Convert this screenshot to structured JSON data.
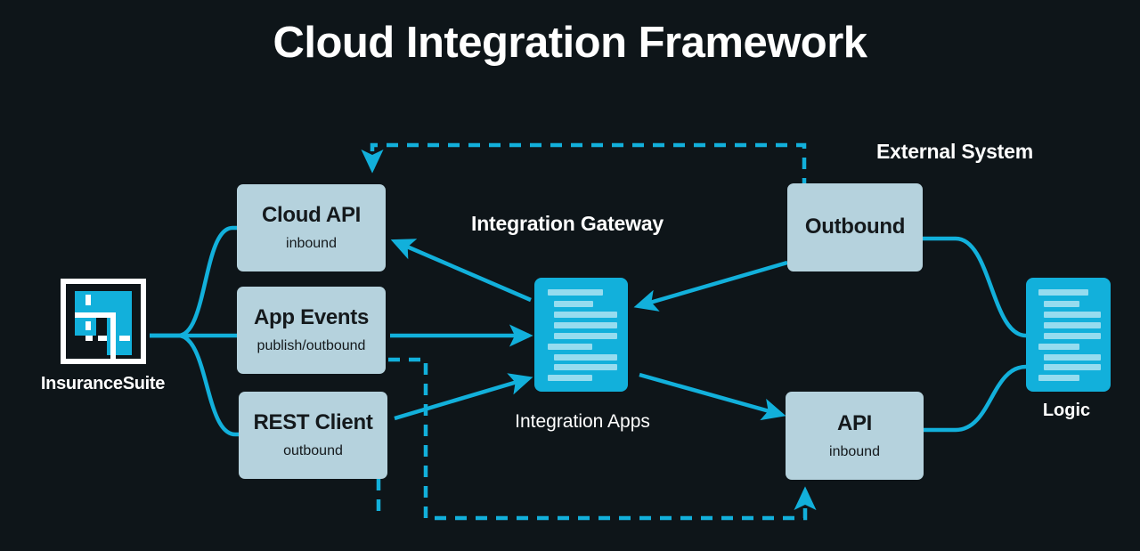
{
  "page": {
    "title": "Cloud Integration Framework",
    "background_color": "#0e1519"
  },
  "colors": {
    "background": "#0e1519",
    "accent_cyan": "#12b0db",
    "box_fill": "#b5d2dd",
    "box_text": "#14191c",
    "doc_line": "#96dcef",
    "text_white": "#ffffff"
  },
  "headings": {
    "integration_gateway": "Integration Gateway",
    "external_system": "External System"
  },
  "source_system": {
    "label": "InsuranceSuite",
    "icon": "insurancesuite-logo-icon"
  },
  "left_boxes": [
    {
      "title": "Cloud API",
      "subtitle": "inbound"
    },
    {
      "title": "App Events",
      "subtitle": "publish/outbound"
    },
    {
      "title": "REST Client",
      "subtitle": "outbound"
    }
  ],
  "center_node": {
    "label": "Integration Apps",
    "icon": "document-lines-icon"
  },
  "right_boxes": [
    {
      "title": "Outbound",
      "subtitle": ""
    },
    {
      "title": "API",
      "subtitle": "inbound"
    }
  ],
  "right_node": {
    "label": "Logic",
    "icon": "document-lines-icon"
  },
  "connectors": {
    "solid_arrows": [
      {
        "from": "Integration Apps",
        "to": "Cloud API"
      },
      {
        "from": "App Events",
        "to": "Integration Apps"
      },
      {
        "from": "REST Client",
        "to": "Integration Apps"
      },
      {
        "from": "Outbound",
        "to": "Integration Apps"
      },
      {
        "from": "Integration Apps",
        "to": "API"
      }
    ],
    "dashed_arrows": [
      {
        "from": "Outbound",
        "to": "Cloud API"
      },
      {
        "from": "App Events",
        "to": "API"
      }
    ],
    "curves": [
      {
        "from": "InsuranceSuite",
        "to": "Cloud API"
      },
      {
        "from": "InsuranceSuite",
        "to": "App Events"
      },
      {
        "from": "InsuranceSuite",
        "to": "REST Client"
      },
      {
        "from": "Outbound",
        "to": "Logic"
      },
      {
        "from": "API",
        "to": "Logic"
      }
    ]
  }
}
